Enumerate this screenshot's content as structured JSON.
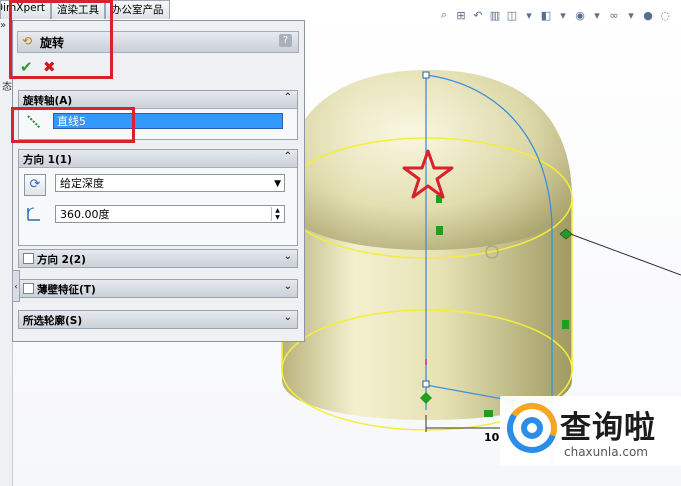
{
  "command_tabs": [
    "DimXpert",
    "渲染工具",
    "办公室产品"
  ],
  "view_toolbar_icons": [
    "zoom-fit-icon",
    "zoom-area-icon",
    "previous-view-icon",
    "section-view-icon",
    "view-orientation-icon",
    "display-style-icon",
    "hide-show-icon",
    "edit-appearance-icon",
    "apply-scene-icon",
    "view-settings-icon"
  ],
  "left_strip": {
    "arrows": "»",
    "char": "态"
  },
  "property_manager": {
    "title": "旋转",
    "help": "?",
    "ok_symbol": "✔",
    "cancel_symbol": "✖",
    "axis_group": {
      "label": "旋转轴(A)",
      "value": "直线5"
    },
    "direction1": {
      "label": "方向 1(1)",
      "end_condition": "给定深度",
      "angle": "360.00度"
    },
    "direction2": {
      "label": "方向 2(2)"
    },
    "thin_feature": {
      "label": "薄壁特征(T)"
    },
    "selected_contours": {
      "label": "所选轮廓(S)"
    }
  },
  "sketch_dimension": "10",
  "watermark": {
    "name": "查询啦",
    "url": "chaxunla.com"
  },
  "colors": {
    "model_fill": "#e9e6b8",
    "edge_yellow": "#f4ee3a",
    "sketch_blue": "#3b8fe0",
    "highlight_red": "#d9222d",
    "selection_blue": "#3399ff",
    "relation_green": "#1ea01e"
  }
}
